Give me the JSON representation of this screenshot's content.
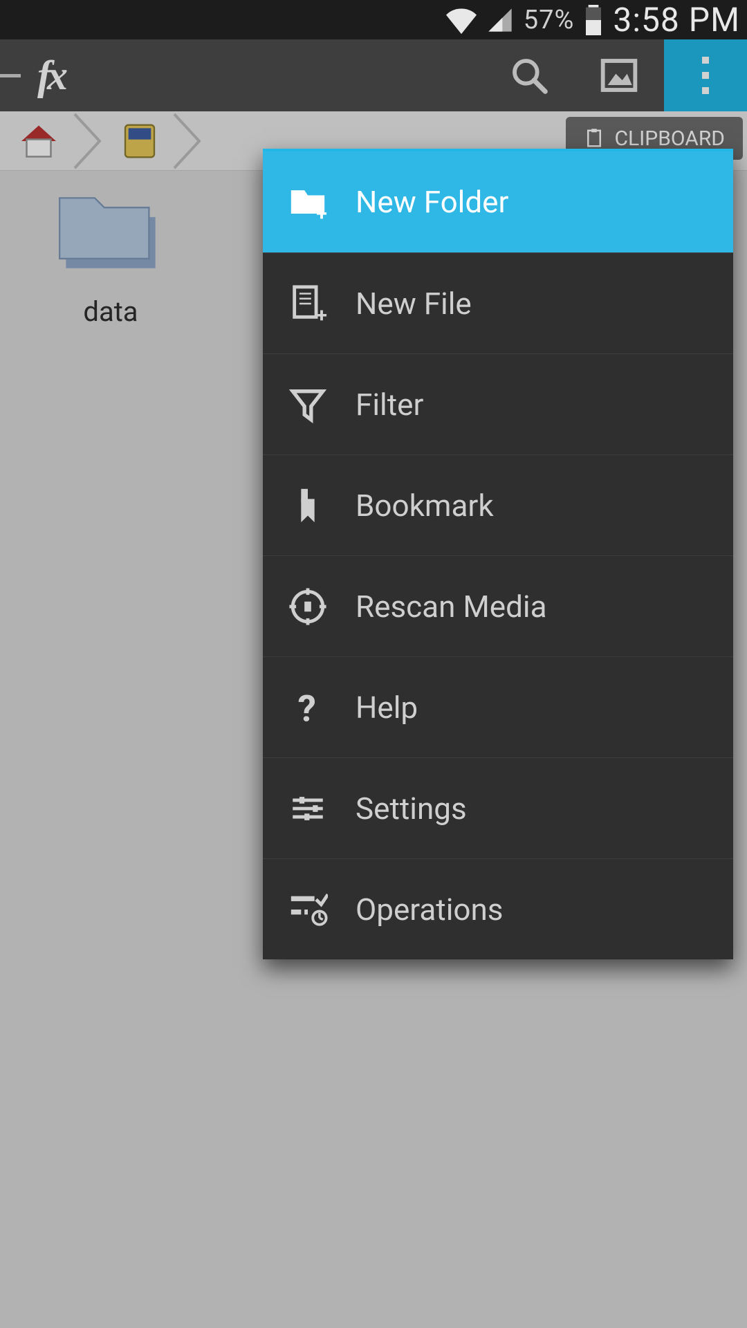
{
  "status": {
    "battery_pct": "57%",
    "clock": "3:58 PM"
  },
  "toolbar": {
    "logo_text": "fx"
  },
  "breadcrumb": {
    "clipboard_label": "CLIPBOARD"
  },
  "content": {
    "folders": [
      {
        "name": "data"
      }
    ]
  },
  "menu": {
    "items": [
      {
        "icon": "folder-plus-icon",
        "label": "New Folder",
        "highlight": true
      },
      {
        "icon": "file-plus-icon",
        "label": "New File",
        "highlight": false
      },
      {
        "icon": "filter-icon",
        "label": "Filter",
        "highlight": false
      },
      {
        "icon": "bookmark-icon",
        "label": "Bookmark",
        "highlight": false
      },
      {
        "icon": "rescan-icon",
        "label": "Rescan Media",
        "highlight": false
      },
      {
        "icon": "help-icon",
        "label": "Help",
        "highlight": false
      },
      {
        "icon": "settings-icon",
        "label": "Settings",
        "highlight": false
      },
      {
        "icon": "operations-icon",
        "label": "Operations",
        "highlight": false
      }
    ]
  },
  "colors": {
    "accent": "#21b7e6"
  }
}
